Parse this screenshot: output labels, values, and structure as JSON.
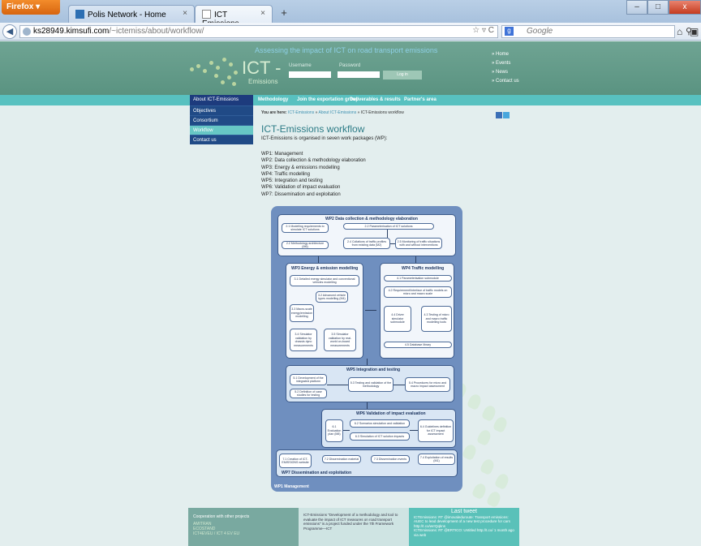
{
  "browser": {
    "menu_label": "Firefox ▾",
    "tabs": [
      {
        "label": "Polis Network - Home"
      },
      {
        "label": "ICT Emissions"
      }
    ],
    "tab_close": "×",
    "new_tab": "+",
    "url_domain": "ks28949.kimsufi.com",
    "url_path": "/~ictemiss/about/workflow/",
    "url_controls": "☆ ▿ C",
    "search_placeholder": "Google",
    "search_engine_icon": "g",
    "win_min": "–",
    "win_max": "□",
    "win_close": "x"
  },
  "header": {
    "tagline": "Assessing the impact of ICT on road transport emissions",
    "logo_main": "ICT -",
    "logo_sub": "Emissions",
    "username_label": "Username",
    "password_label": "Password",
    "login_button": "Log in",
    "top_links": [
      "» Home",
      "» Events",
      "» News",
      "» Contact us"
    ]
  },
  "nav": {
    "items": [
      "Methodology",
      "Join the exportation group",
      "Deliverables & results",
      "Partner's area"
    ]
  },
  "sidebar": {
    "header": "About ICT-Emissions",
    "items": [
      "Objectives",
      "Consortium",
      "Workflow",
      "Contact us"
    ]
  },
  "breadcrumb": {
    "prefix": "You are here: ",
    "links": [
      "ICT-Emissions",
      "About ICT-Emissions"
    ],
    "separator": " » ",
    "current": "ICT-Emissions workflow"
  },
  "page": {
    "title": "ICT-Emissions workflow",
    "intro": "ICT-Emissions is organised in seven work packages (WP):",
    "workpackages": [
      "WP1: Management",
      "WP2: Data collection & methodology elaboration",
      "WP3: Energy & emissions modelling",
      "WP4: Traffic modelling",
      "WP5: Integration and testing",
      "WP6: Validation of impact evaluation",
      "WP7: Dissemination and exploitation"
    ]
  },
  "diagram": {
    "wp2": {
      "title": "WP2 Data collection & methodology elaboration",
      "boxes": [
        "2.1 Modelling requirements to simulate ICT solutions",
        "2.2 Parameterisation of ICT solutions",
        "2.2 Methodology architecture (M6)",
        "2.4 Collations of traffic profiles from existing data (M2)",
        "2.5 Monitoring of traffic situations with and without interventions"
      ]
    },
    "wp3": {
      "title": "WP3 Energy & emission modelling",
      "boxes": [
        "3.1 Detailed energy simulator and conventional vehicles modelling",
        "3.2 Advanced vehicle types modelling (M4)",
        "3.3 Macro-scale energy/emission modelling",
        "3.4 Simulator validation by chassis dyno measurements",
        "3.5 Simulator validation by real-world on-board measurements"
      ]
    },
    "wp4": {
      "title": "WP4 Traffic modelling",
      "boxes": [
        "4.1 Parameterisation submodule",
        "4.2 Requirement/Interface of traffic models on micro and macro scale",
        "4.4 Driver simulator submodule",
        "4.3 Testing of micro and macro traffic modelling tools",
        "4.5 Database library"
      ]
    },
    "wp5": {
      "title": "WP5 Integration and testing",
      "boxes": [
        "5.1 Development of the integrated platform",
        "5.2 Definition of case studies for testing",
        "5.3 Testing and validation of the methodology",
        "5.4 Procedures for micro and macro impact assessment"
      ]
    },
    "wp6": {
      "title": "WP6 Validation of impact evaluation",
      "boxes": [
        "6.1 Evaluation plan (M8)",
        "6.2 Scenarios simulation and validation",
        "6.3 Simulation of ICT solution impacts",
        "6.4 Guidelines definition for ICT impact assessment"
      ]
    },
    "wp7": {
      "title": "WP7 Dissemination and exploitation",
      "boxes": [
        "7.1 Creation of ICT-EMISSIONS website",
        "7.2 Dissemination material",
        "7.3 Dissemination events",
        "7.4 Exploitation of results (M1)"
      ]
    },
    "wp1": {
      "title": "WP1 Management"
    }
  },
  "footer": {
    "col1_title": "Cooperation with other projects",
    "col1_items": [
      "AMITRAN",
      "ECOSTAND",
      "ICT4EVEU / ICT 4 EV EU"
    ],
    "col2_text": "ICT-Emissions \"Development of a methodology and tool to evaluate the impact of ICT measures on road transport emissions\" is a project funded under the 7th Framework Programme—ICT",
    "col3_title": "Last tweet",
    "col3_text": "ICTEmissions: RT @imovaleduroute: Transport emissions: AUEC to lead development of a new test procedure for cars http://t.co/wrrQqkns",
    "col3_text2": "ICTEmissions: RT @ERTICO: Untitled http://t.co/ 1 month ago via web"
  }
}
